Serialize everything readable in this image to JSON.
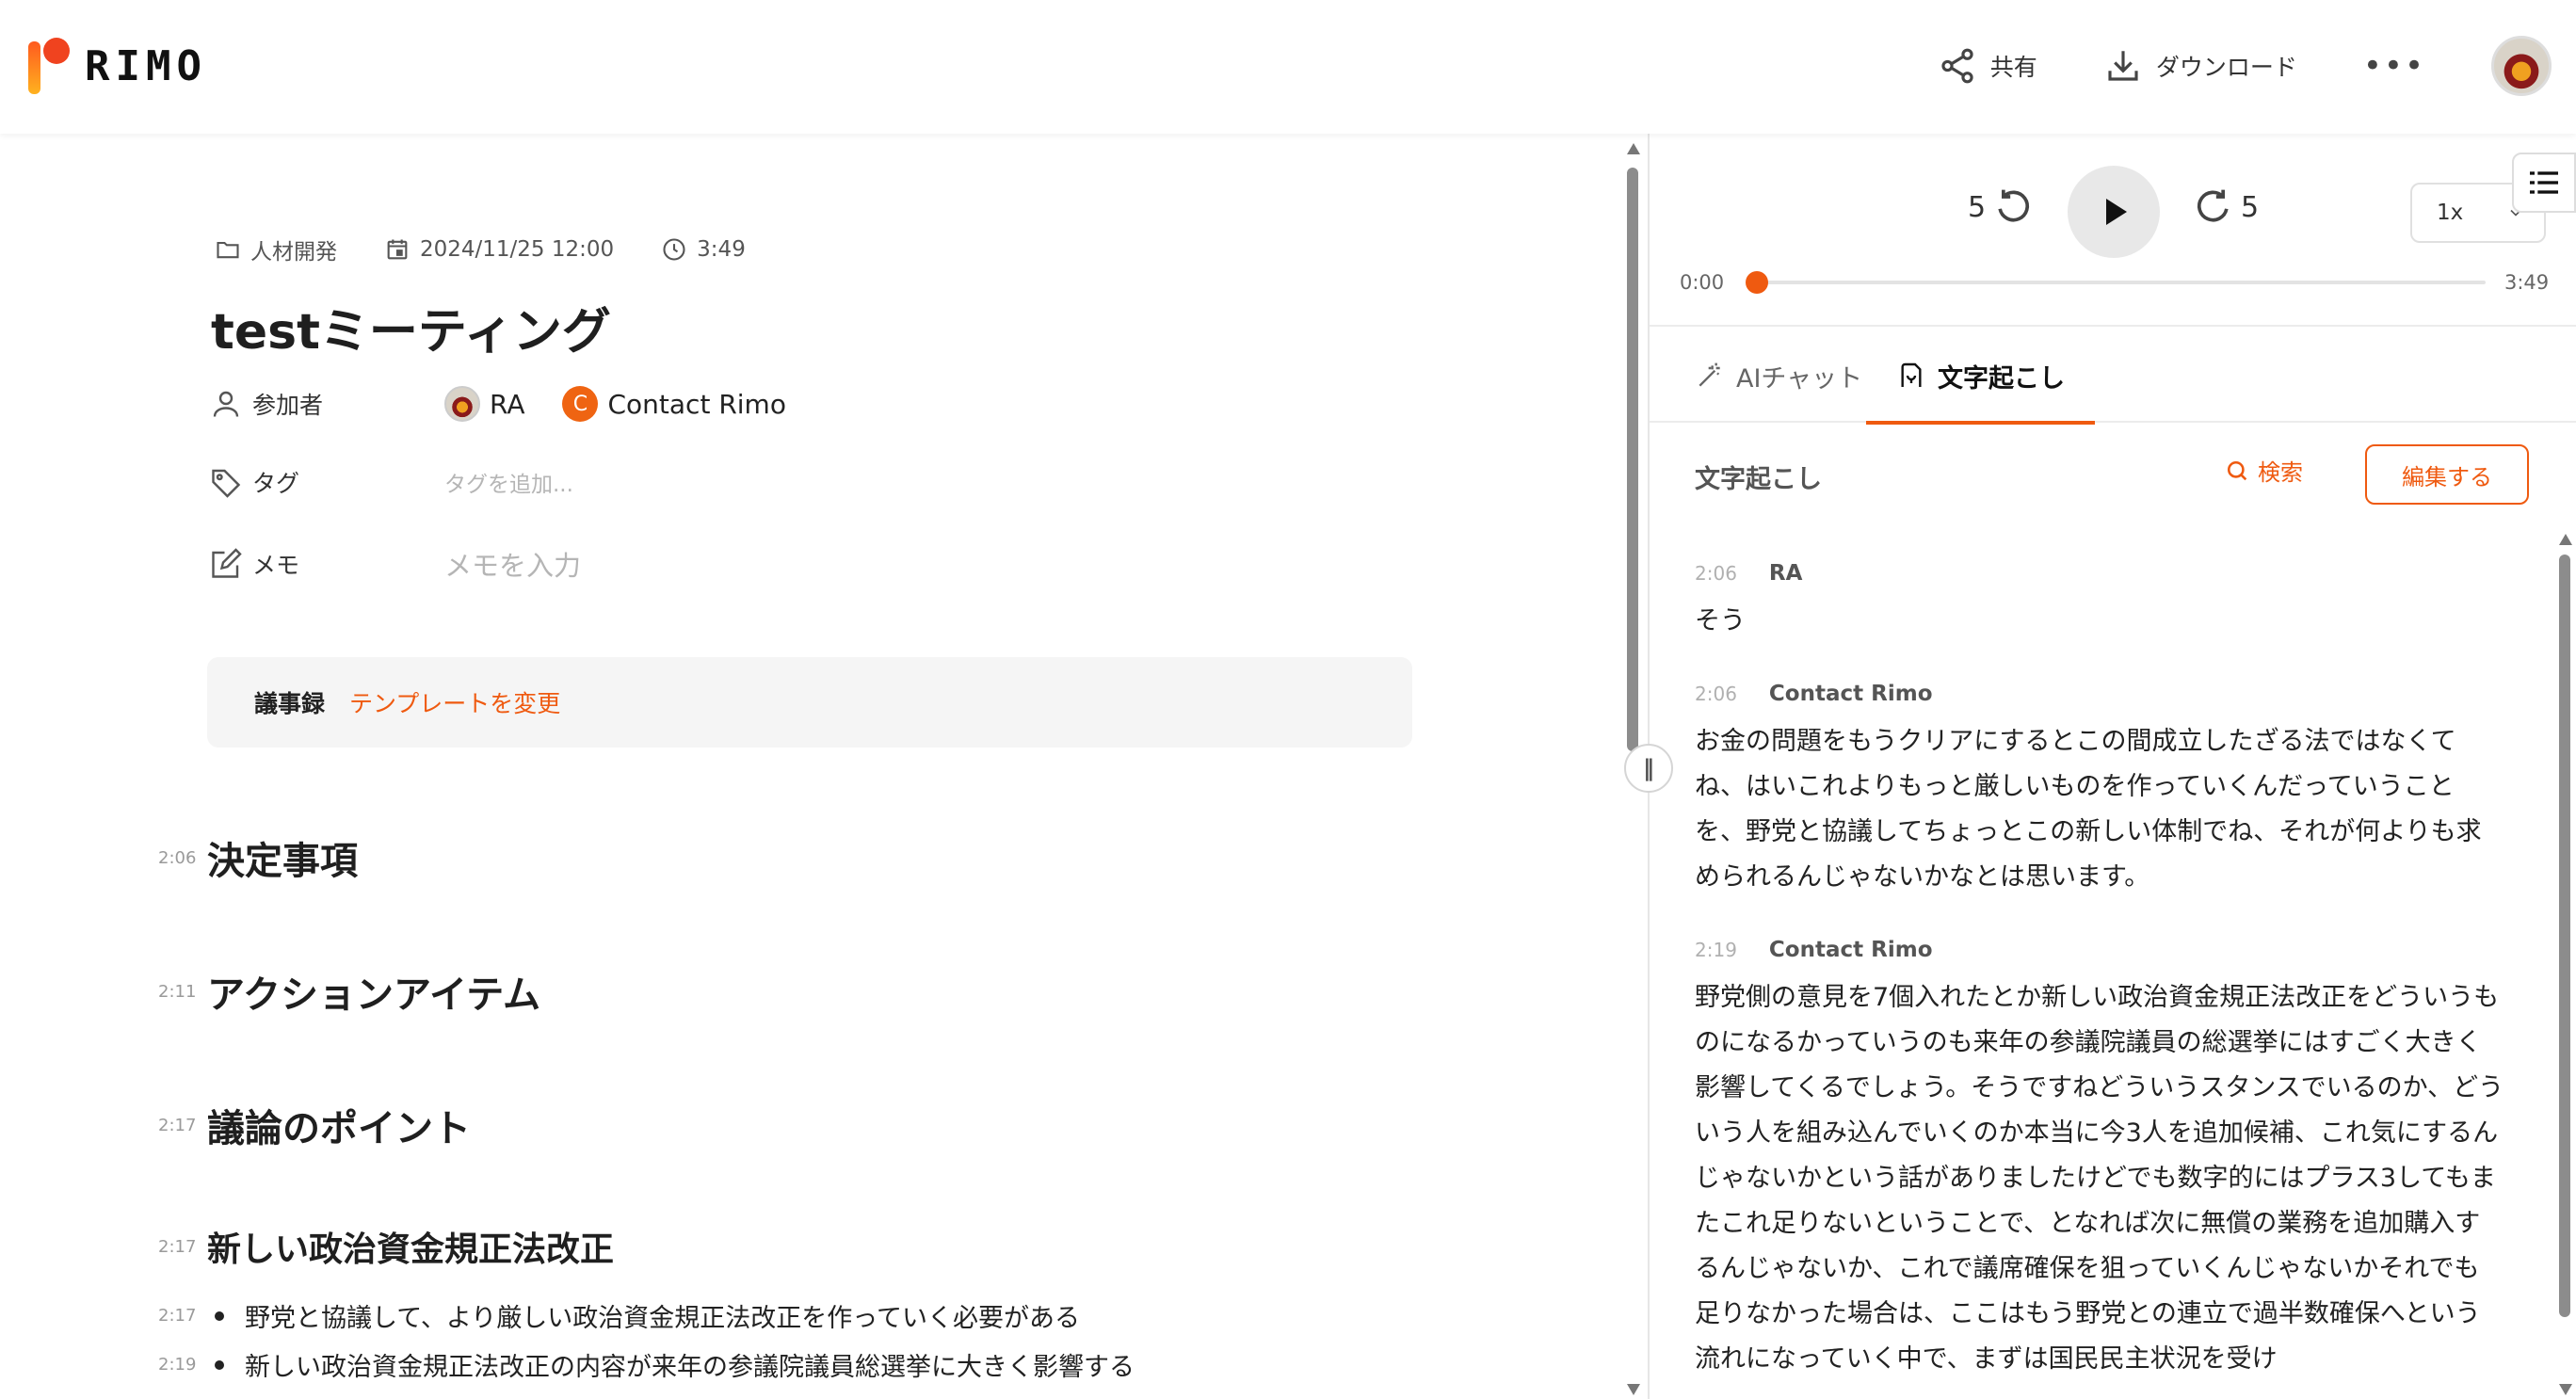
{
  "app": {
    "logo_text": "RIMO",
    "accent_color": "#ef5a10"
  },
  "header": {
    "share_label": "共有",
    "download_label": "ダウンロード",
    "more_label": "•••"
  },
  "meeting": {
    "folder": "人材開発",
    "datetime": "2024/11/25 12:00",
    "duration": "3:49",
    "title": "testミーティング",
    "participants_label": "参加者",
    "participants": [
      {
        "name": "RA",
        "initial": ""
      },
      {
        "name": "Contact Rimo",
        "initial": "C"
      }
    ],
    "tags_label": "タグ",
    "tags_placeholder": "タグを追加...",
    "memo_label": "メモ",
    "memo_placeholder": "メモを入力"
  },
  "minutes": {
    "label": "議事録",
    "template_link": "テンプレートを変更",
    "sections": [
      {
        "ts": "2:06",
        "heading": "決定事項"
      },
      {
        "ts": "2:11",
        "heading": "アクションアイテム"
      },
      {
        "ts": "2:17",
        "heading": "議論のポイント"
      },
      {
        "ts": "2:17",
        "heading": "新しい政治資金規正法改正"
      }
    ],
    "bullets": [
      {
        "ts": "2:17",
        "text": "野党と協議して、より厳しい政治資金規正法改正を作っていく必要がある"
      },
      {
        "ts": "2:19",
        "text": "新しい政治資金規正法改正の内容が来年の参議院議員総選挙に大きく影響する"
      }
    ]
  },
  "player": {
    "skip_back": "5",
    "skip_forward": "5",
    "speed": "1x",
    "current_time": "0:00",
    "total_time": "3:49",
    "progress": 0
  },
  "tabs": [
    {
      "label": "AIチャット",
      "active": false
    },
    {
      "label": "文字起こし",
      "active": true
    }
  ],
  "transcript": {
    "heading": "文字起こし",
    "search_label": "検索",
    "edit_label": "編集する",
    "segments": [
      {
        "ts": "2:06",
        "speaker": "RA",
        "text": "そう"
      },
      {
        "ts": "2:06",
        "speaker": "Contact Rimo",
        "text": "お金の問題をもうクリアにするとこの間成立したざる法ではなくてね、はいこれよりもっと厳しいものを作っていくんだっていうことを、野党と協議してちょっとこの新しい体制でね、それが何よりも求められるんじゃないかなとは思います。"
      },
      {
        "ts": "2:19",
        "speaker": "Contact Rimo",
        "text": "野党側の意見を7個入れたとか新しい政治資金規正法改正をどういうものになるかっていうのも来年の参議院議員の総選挙にはすごく大きく影響してくるでしょう。そうですねどういうスタンスでいるのか、どういう人を組み込んでいくのか本当に今3人を追加候補、これ気にするんじゃないかという話がありましたけどでも数字的にはプラス3してもまたこれ足りないということで、となれば次に無償の業務を追加購入するんじゃないか、これで議席確保を狙っていくんじゃないかそれでも足りなかった場合は、ここはもう野党との連立で過半数確保へという流れになっていく中で、まずは国民民主状況を受け"
      }
    ]
  }
}
